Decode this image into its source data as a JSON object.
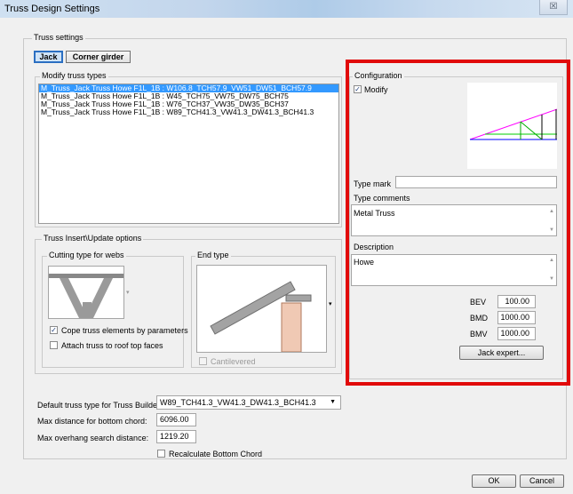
{
  "window": {
    "title": "Truss Design Settings",
    "close_glyph": "☒"
  },
  "truss_settings": {
    "label": "Truss settings",
    "tabs": [
      {
        "label": "Jack"
      },
      {
        "label": "Corner girder"
      }
    ]
  },
  "modify_truss_types": {
    "label": "Modify truss types",
    "items": [
      "M_Truss_Jack Truss Howe F1L_1B : W106.8_TCH57.9_VW51_DW51_BCH57.9",
      "M_Truss_Jack Truss Howe F1L_1B : W45_TCH75_VW75_DW75_BCH75",
      "M_Truss_Jack Truss Howe F1L_1B : W76_TCH37_VW35_DW35_BCH37",
      "M_Truss_Jack Truss Howe F1L_1B : W89_TCH41.3_VW41.3_DW41.3_BCH41.3"
    ],
    "selected_index": 0
  },
  "insert_update": {
    "label": "Truss Insert\\Update options",
    "cutting_type_label": "Cutting type for webs",
    "end_type_label": "End type",
    "cope_label": "Cope truss elements by parameters",
    "cope_checked": true,
    "attach_label": "Attach truss to roof top faces",
    "attach_checked": false,
    "cantilevered_label": "Cantilevered",
    "cantilevered_checked": false
  },
  "configuration": {
    "label": "Configuration",
    "modify_label": "Modify",
    "modify_checked": true,
    "type_mark_label": "Type mark",
    "type_mark_value": "",
    "type_comments_label": "Type comments",
    "type_comments_value": "Metal Truss",
    "description_label": "Description",
    "description_value": "Howe",
    "params": [
      {
        "label": "BEV",
        "value": "100.00"
      },
      {
        "label": "BMD",
        "value": "1000.00"
      },
      {
        "label": "BMV",
        "value": "1000.00"
      }
    ],
    "jack_expert_label": "Jack expert...",
    "highlight_color": "#e10a0a"
  },
  "bottom": {
    "default_type_label": "Default truss type for Truss Builder:",
    "default_type_value": "W89_TCH41.3_VW41.3_DW41.3_BCH41.3",
    "max_bottom_label": "Max distance for bottom chord:",
    "max_bottom_value": "6096.00",
    "max_overhang_label": "Max overhang search distance:",
    "max_overhang_value": "1219.20",
    "recalc_label": "Recalculate Bottom Chord",
    "recalc_checked": false
  },
  "footer": {
    "ok_label": "OK",
    "cancel_label": "Cancel"
  }
}
